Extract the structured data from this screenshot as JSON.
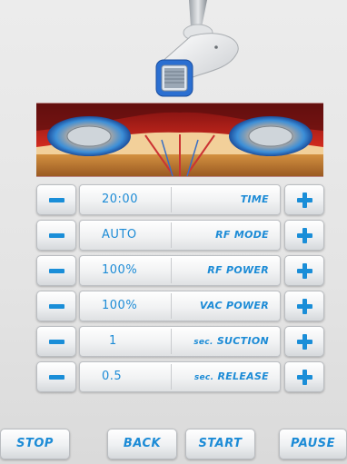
{
  "rows": [
    {
      "value": "20:00",
      "label": "TIME",
      "label_prefix": ""
    },
    {
      "value": "AUTO",
      "label": "RF MODE",
      "label_prefix": ""
    },
    {
      "value": "100%",
      "label": "RF POWER",
      "label_prefix": ""
    },
    {
      "value": "100%",
      "label": "VAC POWER",
      "label_prefix": ""
    },
    {
      "value": "1",
      "label": "SUCTION",
      "label_prefix": "sec."
    },
    {
      "value": "0.5",
      "label": "RELEASE",
      "label_prefix": "sec."
    }
  ],
  "buttons": {
    "stop": "STOP",
    "back": "BACK",
    "start": "START",
    "pause": "PAUSE"
  },
  "colors": {
    "accent": "#1c8bd6",
    "button_face": "#eef0f2"
  },
  "icons": {
    "minus": "minus-icon",
    "plus": "plus-icon"
  }
}
